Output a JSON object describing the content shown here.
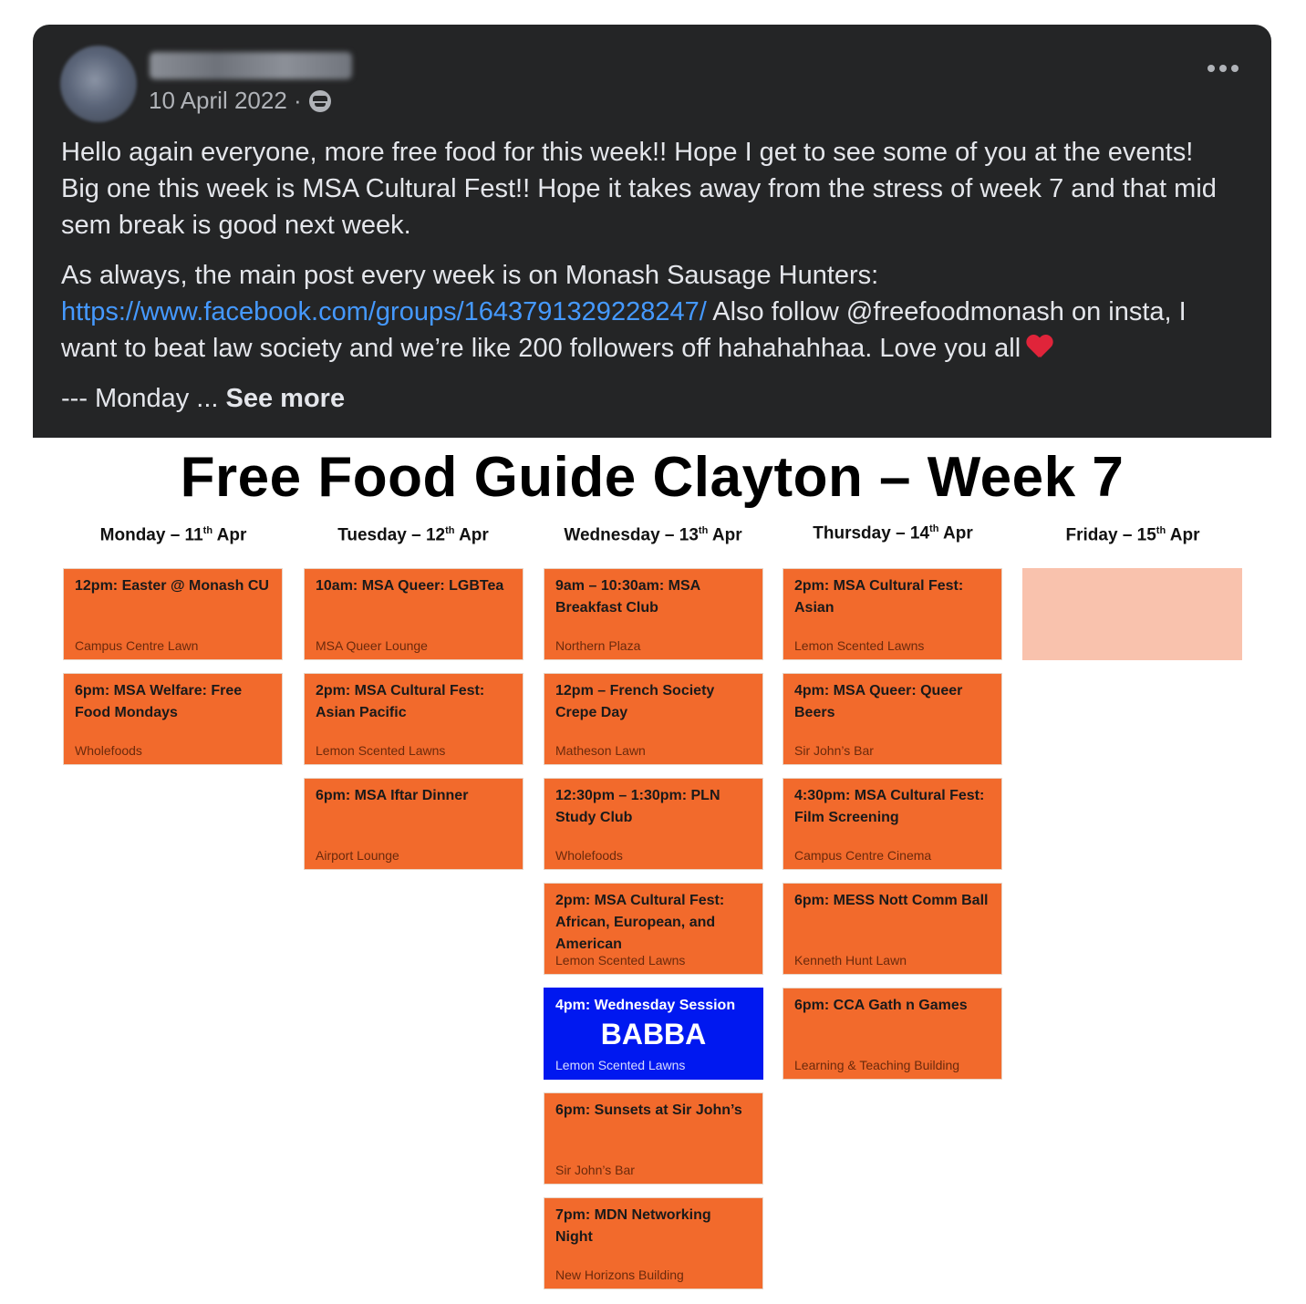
{
  "post": {
    "date": "10 April 2022 ·",
    "paragraph1": "Hello again everyone, more free food for this week!! Hope I get to see some of you at the events! Big one this week is MSA Cultural Fest!! Hope it takes away from the stress of week 7 and that mid sem break is good next week.",
    "paragraph2_start": "As always, the main post every week is on Monash Sausage Hunters: ",
    "link": "https://www.facebook.com/groups/1643791329228247/",
    "paragraph2_end": " Also follow @freefoodmonash on insta, I want to beat law society and we’re like 200 followers off hahahahhaa. Love you all",
    "paragraph3": "--- Monday ... ",
    "see_more": "See more",
    "privacy_icon": "globe-icon",
    "more_icon": "more-options-icon"
  },
  "flyer": {
    "title": "Free Food Guide Clayton – Week 7",
    "days": [
      {
        "name": "Monday – 11",
        "sup": "th",
        "month": " Apr"
      },
      {
        "name": "Tuesday – 12",
        "sup": "th",
        "month": " Apr"
      },
      {
        "name": "Wednesday – 13",
        "sup": "th",
        "month": " Apr"
      },
      {
        "name": "Thursday – 14",
        "sup": "th",
        "month": " Apr"
      },
      {
        "name": "Friday – 15",
        "sup": "th",
        "month": " Apr"
      }
    ],
    "monday": [
      {
        "title": "12pm: Easter @ Monash CU",
        "location": "Campus Centre Lawn"
      },
      {
        "title": "6pm: MSA Welfare: Free Food Mondays",
        "location": "Wholefoods"
      }
    ],
    "tuesday": [
      {
        "title": "10am: MSA Queer: LGBTea",
        "location": "MSA Queer Lounge"
      },
      {
        "title": "2pm: MSA Cultural Fest: Asian Pacific",
        "location": "Lemon Scented Lawns"
      },
      {
        "title": "6pm: MSA Iftar Dinner",
        "location": "Airport Lounge"
      }
    ],
    "wednesday": [
      {
        "title": "9am – 10:30am: MSA Breakfast Club",
        "location": "Northern Plaza"
      },
      {
        "title": "12pm – French Society Crepe Day",
        "location": "Matheson Lawn"
      },
      {
        "title": "12:30pm – 1:30pm: PLN Study Club",
        "location": "Wholefoods"
      },
      {
        "title": "2pm: MSA Cultural Fest: African, European, and American",
        "location": "Lemon Scented Lawns"
      },
      {
        "title": "4pm: Wednesday Session",
        "highlight": "BABBA",
        "location": "Lemon Scented Lawns"
      },
      {
        "title": "6pm: Sunsets at Sir John’s",
        "location": "Sir John’s Bar"
      },
      {
        "title": "7pm: MDN Networking Night",
        "location": "New Horizons Building"
      }
    ],
    "thursday": [
      {
        "title": "2pm: MSA Cultural Fest: Asian",
        "location": "Lemon Scented Lawns"
      },
      {
        "title": "4pm: MSA Queer: Queer Beers",
        "location": "Sir John’s Bar"
      },
      {
        "title": "4:30pm: MSA Cultural Fest: Film Screening",
        "location": "Campus Centre Cinema"
      },
      {
        "title": "6pm: MESS Nott Comm Ball",
        "location": "Kenneth Hunt Lawn"
      },
      {
        "title": "6pm: CCA Gath n Games",
        "location": "Learning & Teaching Building"
      }
    ],
    "colors": {
      "event": "#f26a2c",
      "highlight": "#0018f0",
      "empty": "#f9c2ad"
    }
  }
}
